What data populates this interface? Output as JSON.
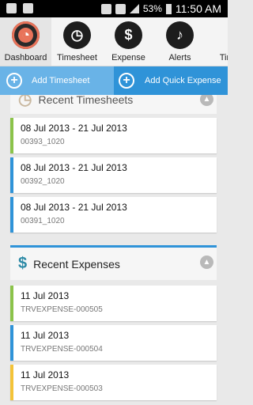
{
  "status_bar": {
    "battery": "53%",
    "time": "11:50 AM"
  },
  "nav": {
    "items": [
      {
        "label": "Dashboard",
        "glyph": "◔",
        "icon": "dashboard-icon"
      },
      {
        "label": "Timesheet",
        "glyph": "◷",
        "icon": "timesheet-icon"
      },
      {
        "label": "Expense",
        "glyph": "$",
        "icon": "dollar-icon"
      },
      {
        "label": "Alerts",
        "glyph": "♪",
        "icon": "bell-icon"
      },
      {
        "label": "Times",
        "glyph": "",
        "icon": ""
      }
    ]
  },
  "actions": {
    "add_timesheet": "Add Timesheet",
    "add_quick_expense": "Add Quick Expense"
  },
  "timesheets": {
    "title": "Recent Timesheets",
    "items": [
      {
        "period": "08 Jul 2013 - 21 Jul 2013",
        "id": "00393_1020"
      },
      {
        "period": "08 Jul 2013 - 21 Jul 2013",
        "id": "00392_1020"
      },
      {
        "period": "08 Jul 2013 - 21 Jul 2013",
        "id": "00391_1020"
      }
    ]
  },
  "expenses": {
    "title": "Recent Expenses",
    "items": [
      {
        "date": "11 Jul 2013",
        "id": "TRVEXPENSE-000505"
      },
      {
        "date": "11 Jul 2013",
        "id": "TRVEXPENSE-000504"
      },
      {
        "date": "11 Jul 2013",
        "id": "TRVEXPENSE-000503"
      }
    ]
  },
  "colors": {
    "green": "#8bc34a",
    "blue": "#2f93d8",
    "yellow": "#f3c338",
    "accent": "#2f93d8"
  }
}
